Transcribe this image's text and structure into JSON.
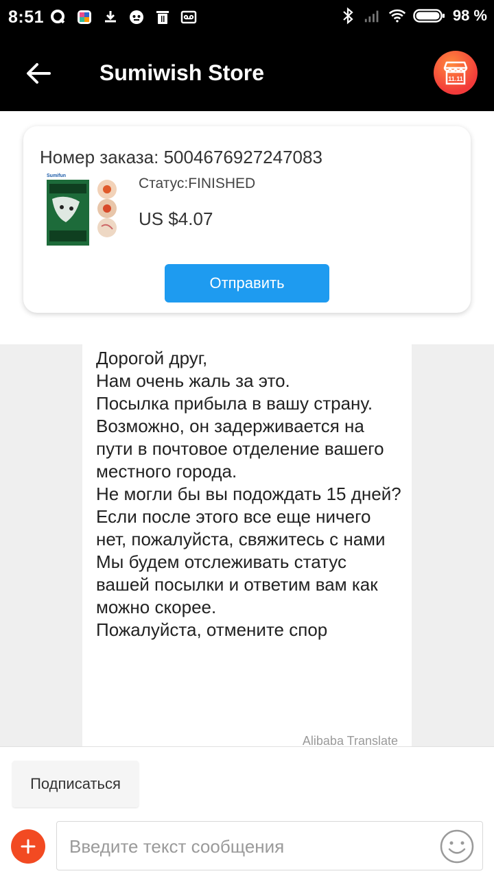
{
  "status_bar": {
    "time": "8:51",
    "battery_percent": "98 %",
    "battery_level": 0.98
  },
  "header": {
    "title": "Sumiwish Store"
  },
  "order": {
    "number_label": "Номер заказа: 5004676927247083",
    "status_text": "Статус:FINISHED",
    "price": "US $4.07",
    "send_label": "Отправить",
    "product_brand": "Sumifun"
  },
  "message": {
    "text": "Дорогой друг,\nНам очень жаль за это.\nПосылка прибыла в вашу страну.\nВозможно, он задерживается на пути в почтовое отделение вашего местного города.\nНе могли бы вы подождать 15 дней?\nЕсли после этого все еще ничего нет, пожалуйста, свяжитесь с нами\nМы будем отслеживать статус вашей посылки и ответим вам как можно скорее.\nПожалуйста, отмените спор",
    "translate_note": "Alibaba Translate"
  },
  "bottom": {
    "subscribe_label": "Подписаться",
    "input_placeholder": "Введите текст сообщения"
  },
  "colors": {
    "accent": "#1e9bf0",
    "add_button": "#f24a22",
    "store_button": "#f23a3a",
    "header_bg": "#000000"
  }
}
